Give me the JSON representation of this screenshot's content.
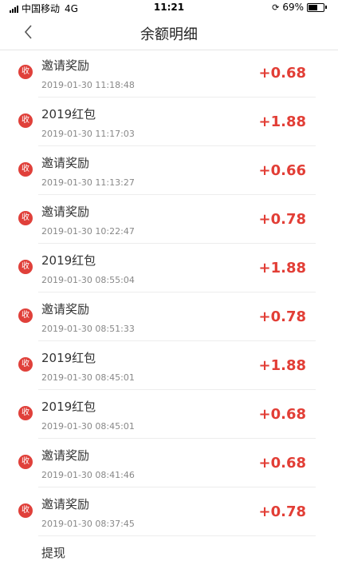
{
  "status": {
    "carrier": "中国移动",
    "network": "4G",
    "time": "11:21",
    "battery": "69%",
    "battery_level": 0.69
  },
  "nav": {
    "title": "余额明细",
    "back_icon": "chevron-left-icon"
  },
  "colors": {
    "accent": "#e23e36",
    "badge": "#e0403a"
  },
  "transactions": [
    {
      "badge": "收",
      "title": "邀请奖励",
      "time": "2019-01-30 11:18:48",
      "amount": "+0.68"
    },
    {
      "badge": "收",
      "title": "2019红包",
      "time": "2019-01-30 11:17:03",
      "amount": "+1.88"
    },
    {
      "badge": "收",
      "title": "邀请奖励",
      "time": "2019-01-30 11:13:27",
      "amount": "+0.66"
    },
    {
      "badge": "收",
      "title": "邀请奖励",
      "time": "2019-01-30 10:22:47",
      "amount": "+0.78"
    },
    {
      "badge": "收",
      "title": "2019红包",
      "time": "2019-01-30 08:55:04",
      "amount": "+1.88"
    },
    {
      "badge": "收",
      "title": "邀请奖励",
      "time": "2019-01-30 08:51:33",
      "amount": "+0.78"
    },
    {
      "badge": "收",
      "title": "2019红包",
      "time": "2019-01-30 08:45:01",
      "amount": "+1.88"
    },
    {
      "badge": "收",
      "title": "2019红包",
      "time": "2019-01-30 08:45:01",
      "amount": "+0.68"
    },
    {
      "badge": "收",
      "title": "邀请奖励",
      "time": "2019-01-30 08:41:46",
      "amount": "+0.68"
    },
    {
      "badge": "收",
      "title": "邀请奖励",
      "time": "2019-01-30 08:37:45",
      "amount": "+0.78"
    }
  ],
  "partial_row": {
    "title": "提现"
  }
}
